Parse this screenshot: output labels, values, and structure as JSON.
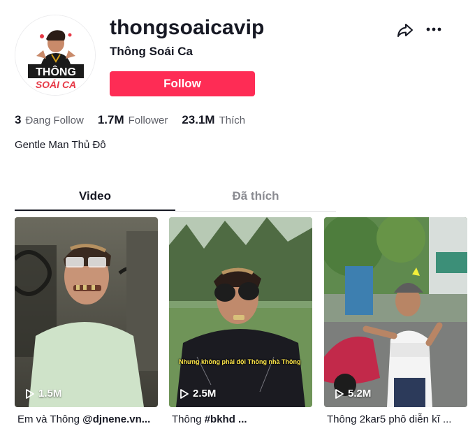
{
  "profile": {
    "username": "thongsoaicavip",
    "nickname": "Thông Soái Ca",
    "follow_label": "Follow",
    "bio": "Gentle Man Thủ Đô",
    "avatar_text_line1": "THÔNG",
    "avatar_text_line2": "SOÁI CA"
  },
  "stats": [
    {
      "value": "3",
      "label": "Đang Follow"
    },
    {
      "value": "1.7M",
      "label": "Follower"
    },
    {
      "value": "23.1M",
      "label": "Thích"
    }
  ],
  "tabs": [
    {
      "label": "Video",
      "active": true
    },
    {
      "label": "Đã thích",
      "active": false
    }
  ],
  "videos": [
    {
      "views": "1.5M",
      "caption_plain": "Em và Thông ",
      "caption_bold": "@djnene.vn..."
    },
    {
      "views": "2.5M",
      "caption_plain": "Thông ",
      "caption_bold": "#bkhd ...",
      "overlay": "Nhưng không phải đội Thông nhà Thông"
    },
    {
      "views": "5.2M",
      "caption_plain": "Thông 2kar5 phô diễn kĩ ...",
      "caption_bold": ""
    }
  ],
  "icons": {
    "share": "share-icon",
    "more": "more-icon",
    "play": "play-icon"
  },
  "colors": {
    "accent": "#fe2c55",
    "text": "#161823",
    "muted": "#5c5e66"
  }
}
